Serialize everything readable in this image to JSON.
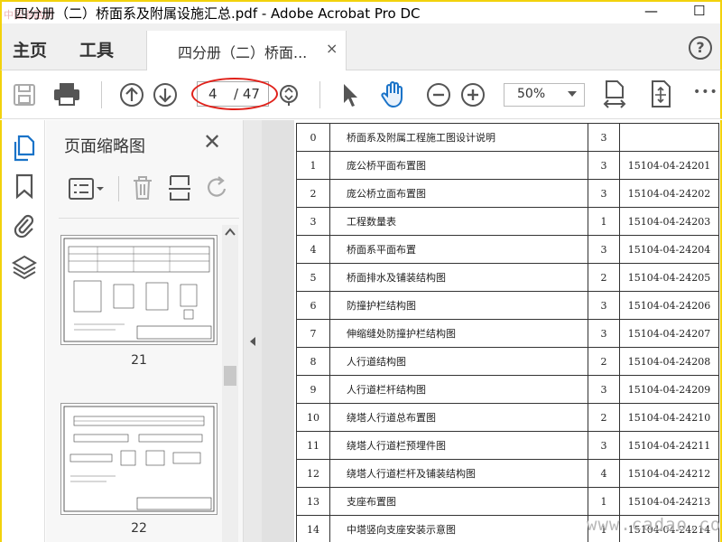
{
  "window": {
    "title": "四分册（二）桥面系及附属设施汇总.pdf - Adobe Acrobat Pro DC",
    "watermark_top": "中国道路网",
    "minimize": "—",
    "maximize": "☐"
  },
  "tabs": {
    "home": "主页",
    "tools": "工具",
    "document": "四分册（二）桥面...",
    "close": "×",
    "help": "?"
  },
  "toolbar": {
    "page_current": "4",
    "page_total": "/ 47",
    "zoom": "50%",
    "more": "•••"
  },
  "panel": {
    "title": "页面缩略图",
    "close": "✕",
    "thumbnails": [
      {
        "page": "21"
      },
      {
        "page": "22"
      }
    ]
  },
  "document": {
    "rows": [
      {
        "no": "0",
        "name": "桥面系及附属工程施工图设计说明",
        "sheets": "3",
        "code": ""
      },
      {
        "no": "1",
        "name": "庞公桥平面布置图",
        "sheets": "3",
        "code": "15104-04-24201"
      },
      {
        "no": "2",
        "name": "庞公桥立面布置图",
        "sheets": "3",
        "code": "15104-04-24202"
      },
      {
        "no": "3",
        "name": "工程数量表",
        "sheets": "1",
        "code": "15104-04-24203"
      },
      {
        "no": "4",
        "name": "桥面系平面布置",
        "sheets": "3",
        "code": "15104-04-24204"
      },
      {
        "no": "5",
        "name": "桥面排水及铺装结构图",
        "sheets": "2",
        "code": "15104-04-24205"
      },
      {
        "no": "6",
        "name": "防撞护栏结构图",
        "sheets": "3",
        "code": "15104-04-24206"
      },
      {
        "no": "7",
        "name": "伸缩缝处防撞护栏结构图",
        "sheets": "3",
        "code": "15104-04-24207"
      },
      {
        "no": "8",
        "name": "人行道结构图",
        "sheets": "2",
        "code": "15104-04-24208"
      },
      {
        "no": "9",
        "name": "人行道栏杆结构图",
        "sheets": "3",
        "code": "15104-04-24209"
      },
      {
        "no": "10",
        "name": "绕塔人行道总布置图",
        "sheets": "2",
        "code": "15104-04-24210"
      },
      {
        "no": "11",
        "name": "绕塔人行道栏预埋件图",
        "sheets": "3",
        "code": "15104-04-24211"
      },
      {
        "no": "12",
        "name": "绕塔人行道栏杆及铺装结构图",
        "sheets": "4",
        "code": "15104-04-24212"
      },
      {
        "no": "13",
        "name": "支座布置图",
        "sheets": "1",
        "code": "15104-04-24213"
      },
      {
        "no": "14",
        "name": "中塔竖向支座安装示意图",
        "sheets": "1",
        "code": "15104-04-24214"
      }
    ]
  },
  "watermark_bottom": "www.cadao.com",
  "colors": {
    "accent_blue": "#1a73c8",
    "annotation_red": "#e0211a",
    "window_border": "#f2d20c"
  }
}
